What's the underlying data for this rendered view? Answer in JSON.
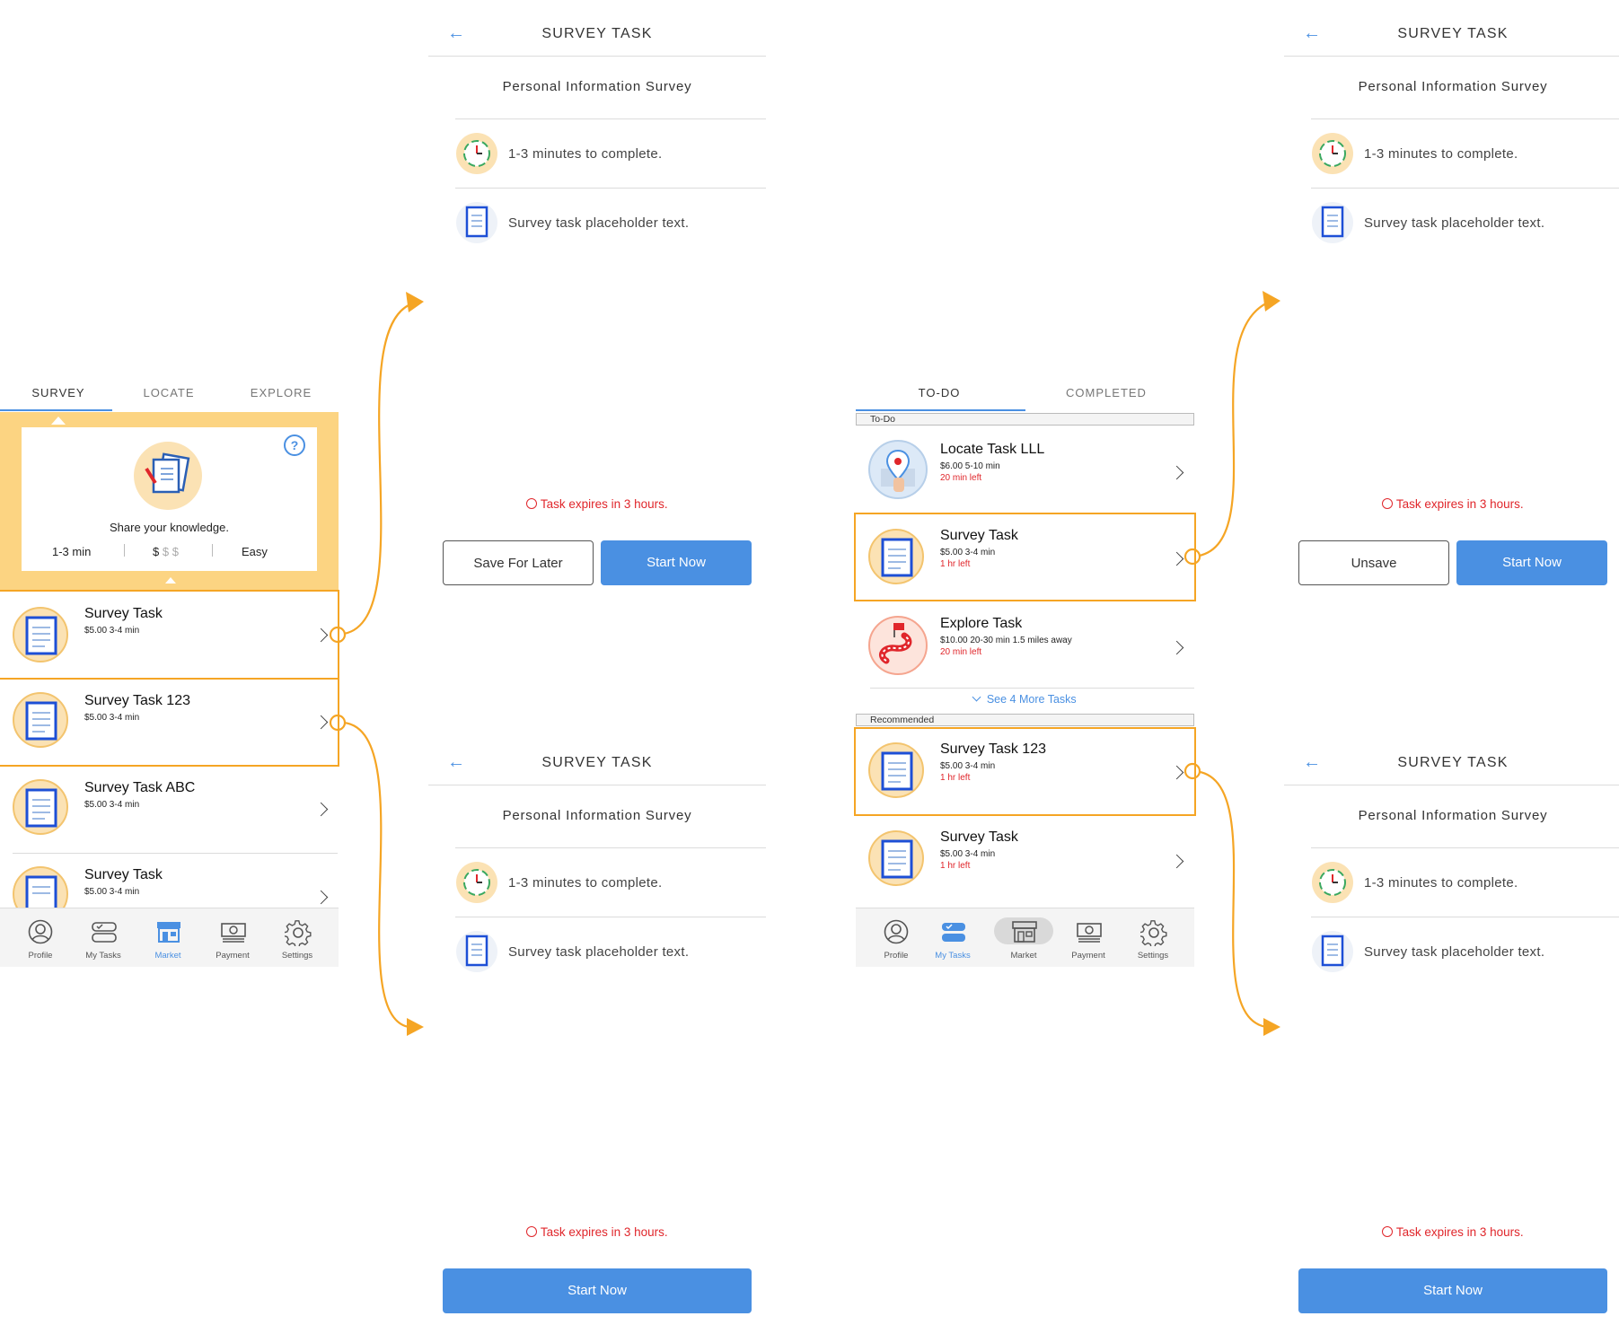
{
  "market": {
    "tabs": [
      "SURVEY",
      "LOCATE",
      "EXPLORE"
    ],
    "banner": {
      "tagline": "Share your knowledge.",
      "time": "1-3 min",
      "pay_active": "$",
      "pay_inactive": "$ $",
      "difficulty": "Easy",
      "help_icon": "question-circle-icon"
    },
    "tasks": [
      {
        "title": "Survey Task",
        "meta": "$5.00  3-4 min"
      },
      {
        "title": "Survey Task 123",
        "meta": "$5.00  3-4 min"
      },
      {
        "title": "Survey Task ABC",
        "meta": "$5.00  3-4 min"
      },
      {
        "title": "Survey Task",
        "meta": "$5.00  3-4 min"
      }
    ],
    "nav": [
      "Profile",
      "My Tasks",
      "Market",
      "Payment",
      "Settings"
    ],
    "nav_active": "Market"
  },
  "my_tasks": {
    "tabs": [
      "TO-DO",
      "COMPLETED"
    ],
    "todo_label": "To-Do",
    "todo": [
      {
        "title": "Locate Task LLL",
        "meta": "$6.00  5-10 min",
        "due": "20 min left",
        "icon": "map-pin-icon"
      },
      {
        "title": "Survey Task",
        "meta": "$5.00  3-4 min",
        "due": "1 hr left",
        "icon": "clipboard-icon"
      },
      {
        "title": "Explore Task",
        "meta": "$10.00  20-30 min  1.5 miles away",
        "due": "20 min left",
        "icon": "route-icon"
      }
    ],
    "see_more": "See 4 More Tasks",
    "recommended_label": "Recommended",
    "recommended": [
      {
        "title": "Survey Task 123",
        "meta": "$5.00  3-4 min",
        "due": "1 hr left"
      },
      {
        "title": "Survey Task",
        "meta": "$5.00  3-4 min",
        "due": "1 hr left"
      }
    ],
    "nav": [
      "Profile",
      "My Tasks",
      "Market",
      "Payment",
      "Settings"
    ],
    "nav_active": "My Tasks"
  },
  "detail": {
    "header": "SURVEY TASK",
    "survey_name": "Personal Information Survey",
    "duration": "1-3 minutes to complete.",
    "description": "Survey task placeholder text.",
    "expires": "Task expires in 3 hours.",
    "save_label": "Save For Later",
    "unsave_label": "Unsave",
    "start_label": "Start Now"
  },
  "colors": {
    "accent_blue": "#4a90e2",
    "highlight_orange": "#f5a524",
    "banner_yellow": "#fcd482",
    "warning_red": "#e0262b"
  }
}
